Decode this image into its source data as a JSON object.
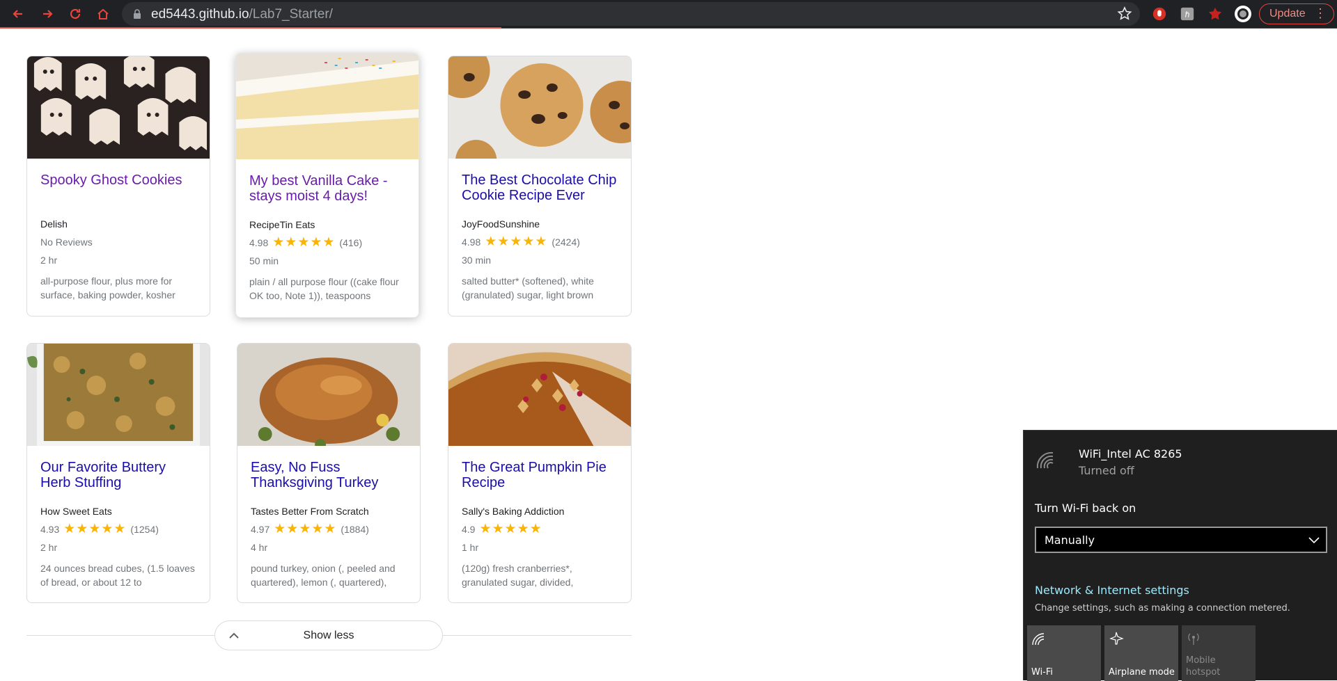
{
  "browser": {
    "url_host": "ed5443.github.io",
    "url_path": "/Lab7_Starter/",
    "update_label": "Update",
    "accent": "#e8453c"
  },
  "recipes": [
    {
      "title": "Spooky Ghost Cookies",
      "org": "Delish",
      "rating": "",
      "stars": "",
      "reviews": "",
      "no_reviews": "No Reviews",
      "time": "2 hr",
      "ingredients": "all-purpose flour, plus more for surface, baking powder, kosher",
      "visited": true
    },
    {
      "title": "My best Vanilla Cake - stays moist 4 days!",
      "org": "RecipeTin Eats",
      "rating": "4.98",
      "stars": "★★★★★",
      "reviews": "(416)",
      "no_reviews": "",
      "time": "50 min",
      "ingredients": "plain / all purpose flour ((cake flour OK too, Note 1)), teaspoons",
      "visited": true
    },
    {
      "title": "The Best Chocolate Chip Cookie Recipe Ever",
      "org": "JoyFoodSunshine",
      "rating": "4.98",
      "stars": "★★★★★",
      "reviews": "(2424)",
      "no_reviews": "",
      "time": "30 min",
      "ingredients": "salted butter* (softened), white (granulated) sugar, light brown",
      "visited": false
    },
    {
      "title": "Our Favorite Buttery Herb Stuffing",
      "org": "How Sweet Eats",
      "rating": "4.93",
      "stars": "★★★★★",
      "reviews": "(1254)",
      "no_reviews": "",
      "time": "2 hr",
      "ingredients": "24 ounces bread cubes, (1.5 loaves of bread, or about 12 to",
      "visited": false
    },
    {
      "title": "Easy, No Fuss Thanksgiving Turkey",
      "org": "Tastes Better From Scratch",
      "rating": "4.97",
      "stars": "★★★★★",
      "reviews": "(1884)",
      "no_reviews": "",
      "time": "4 hr",
      "ingredients": "pound turkey, onion (, peeled and quartered), lemon (, quartered),",
      "visited": false
    },
    {
      "title": "The Great Pumpkin Pie Recipe",
      "org": "Sally's Baking Addiction",
      "rating": "4.9",
      "stars": "★★★★★",
      "reviews": "",
      "no_reviews": "",
      "time": "1 hr",
      "ingredients": "(120g) fresh cranberries*, granulated sugar, divided,",
      "visited": false
    }
  ],
  "show_less_label": "Show less",
  "wifi_flyout": {
    "network_name": "WiFi_Intel AC 8265",
    "network_state": "Turned off",
    "turn_on_label": "Turn Wi-Fi back on",
    "turn_on_value": "Manually",
    "settings_link": "Network & Internet settings",
    "settings_desc": "Change settings, such as making a connection metered.",
    "tiles": [
      {
        "label": "Wi-Fi",
        "icon": "wifi-icon",
        "enabled": true
      },
      {
        "label": "Airplane mode",
        "icon": "airplane-icon",
        "enabled": true
      },
      {
        "label": "Mobile hotspot",
        "icon": "hotspot-icon",
        "enabled": false
      }
    ]
  }
}
